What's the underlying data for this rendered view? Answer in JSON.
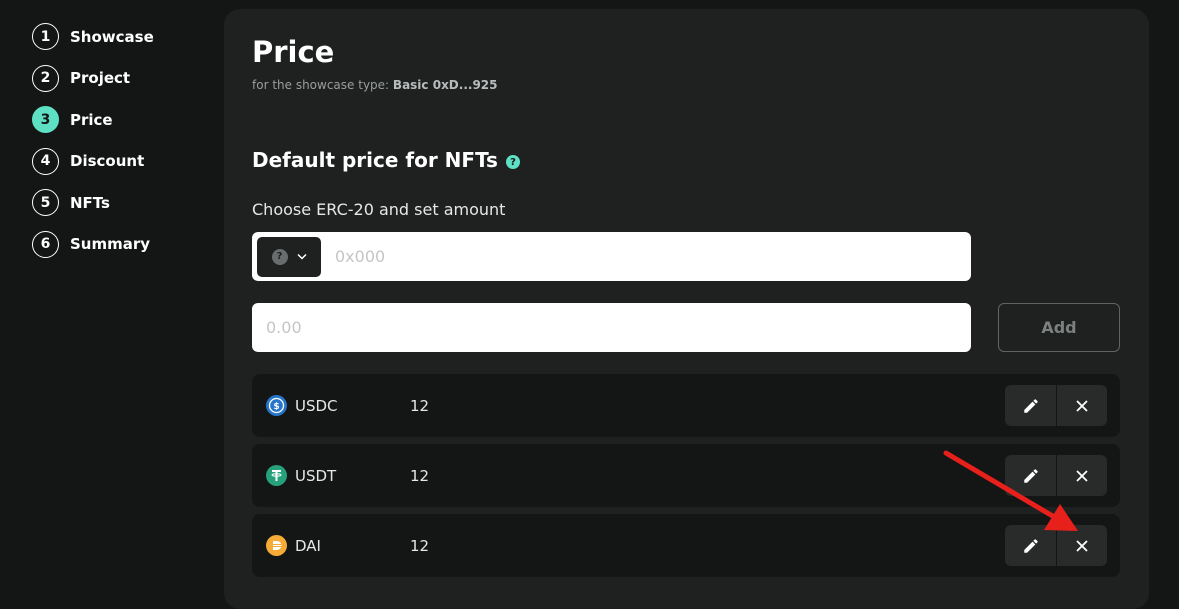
{
  "stepper": [
    {
      "num": "1",
      "label": "Showcase"
    },
    {
      "num": "2",
      "label": "Project"
    },
    {
      "num": "3",
      "label": "Price",
      "active": true
    },
    {
      "num": "4",
      "label": "Discount"
    },
    {
      "num": "5",
      "label": "NFTs"
    },
    {
      "num": "6",
      "label": "Summary"
    }
  ],
  "page": {
    "title": "Price",
    "subtitle_prefix": "for the showcase type:",
    "subtitle_value": "Basic 0xD...925"
  },
  "section": {
    "title": "Default price for NFTs",
    "help_glyph": "?",
    "choose_label": "Choose ERC-20 and set amount"
  },
  "token_select": {
    "glyph": "?",
    "placeholder": "0x000"
  },
  "amount": {
    "placeholder": "0.00"
  },
  "add_button": "Add",
  "prices": [
    {
      "token": "USDC",
      "amount": "12",
      "color": "#2775ca",
      "icon": "usdc-icon"
    },
    {
      "token": "USDT",
      "amount": "12",
      "color": "#26a17b",
      "icon": "usdt-icon"
    },
    {
      "token": "DAI",
      "amount": "12",
      "color": "#f5ac37",
      "icon": "dai-icon"
    }
  ],
  "colors": {
    "accent": "#5ee0c4",
    "annotation_arrow": "#e8201c"
  }
}
